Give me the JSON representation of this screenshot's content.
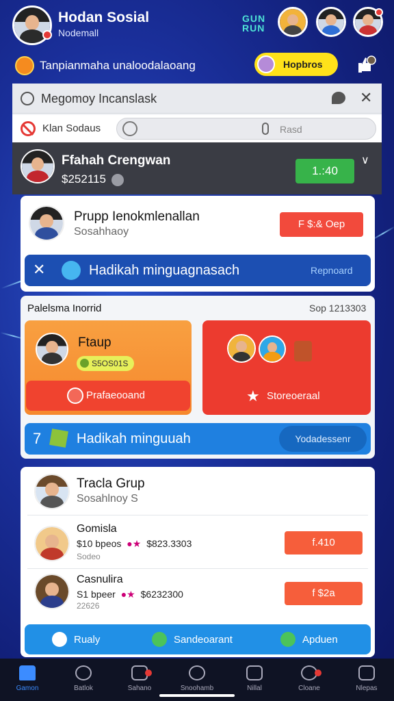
{
  "header": {
    "title": "Hodan Sosial",
    "subtitle": "Nodemall",
    "logo_text": "GUN RUN",
    "tagline": "Tanpianmaha unaloodalaoang",
    "pill_label": "Hopbros"
  },
  "top_card": {
    "title": "Megomoy Incanslask",
    "filter_label": "Klan Sodaus",
    "search_placeholder": "Rasd",
    "user_name": "Ffahah Crengwan",
    "user_amount": "$252115",
    "green_button": "1.:40"
  },
  "group_card": {
    "title": "Prupp Ienokmlenallan",
    "subtitle": "Sosahhaoy",
    "button": "F $:& Oep",
    "banner_text": "Hadikah minguagnasach",
    "banner_link": "Repnoard"
  },
  "reward_section": {
    "heading": "Palelsma Inorrid",
    "heading_right": "Sop 1213303",
    "left_card": {
      "title": "Ftaup",
      "pill": "S5OS01S",
      "button": "Prafaeooand"
    },
    "right_card": {
      "button": "Storeoeraal"
    },
    "banner_number": "7",
    "banner_text": "Hadikah minguuah",
    "banner_button": "Yodadessenr"
  },
  "trade_group": {
    "title": "Tracla Grup",
    "subtitle": "Sosahlnoy S",
    "rows": [
      {
        "name": "Gomisla",
        "price": "$10 bpeos",
        "price2": "$823.3303",
        "meta": "Sodeo",
        "button": "f.410"
      },
      {
        "name": "Casnulira",
        "price": "S1 bpeer",
        "price2": "$6232300",
        "meta": "22626",
        "button": "f $2a"
      }
    ],
    "footer": [
      {
        "label": "Rualy",
        "color": "#ffffff"
      },
      {
        "label": "Sandeoarant",
        "color": "#4cc35a"
      },
      {
        "label": "Apduen",
        "color": "#4cc35a"
      }
    ]
  },
  "tabs": [
    {
      "label": "Gamon",
      "icon": "home-icon",
      "active": true
    },
    {
      "label": "Batlok",
      "icon": "search-icon"
    },
    {
      "label": "Sahano",
      "icon": "camera-icon",
      "badge": true
    },
    {
      "label": "Snoohamb",
      "icon": "circle-icon"
    },
    {
      "label": "Nillal",
      "icon": "user-icon"
    },
    {
      "label": "Cloane",
      "icon": "chat-icon",
      "badge": true
    },
    {
      "label": "Nlepas",
      "icon": "bag-icon"
    }
  ],
  "colors": {
    "accent_blue": "#1c4fb2",
    "accent_red": "#f24a3c",
    "accent_orange": "#f6882d",
    "accent_green": "#37b34a",
    "pill_yellow": "#ffe21a"
  }
}
